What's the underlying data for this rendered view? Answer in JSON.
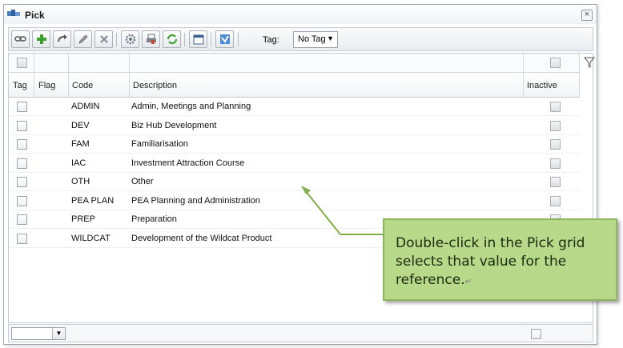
{
  "window": {
    "title": "Pick"
  },
  "toolbar": {
    "tag_label": "Tag:",
    "tag_value": "No Tag",
    "buttons": [
      "link-icon",
      "add-icon",
      "redo-icon",
      "edit-icon",
      "delete-icon",
      "settings-icon",
      "print-icon",
      "refresh-icon",
      "calendar-icon",
      "filter-pick-icon"
    ]
  },
  "grid": {
    "columns": {
      "tag": "Tag",
      "flag": "Flag",
      "code": "Code",
      "description": "Description",
      "inactive": "Inactive"
    },
    "rows": [
      {
        "code": "ADMIN",
        "description": "Admin, Meetings and Planning"
      },
      {
        "code": "DEV",
        "description": "Biz Hub Development"
      },
      {
        "code": "FAM",
        "description": "Familiarisation"
      },
      {
        "code": "IAC",
        "description": "Investment Attraction Course"
      },
      {
        "code": "OTH",
        "description": "Other"
      },
      {
        "code": "PEA PLAN",
        "description": "PEA Planning and Administration"
      },
      {
        "code": "PREP",
        "description": "Preparation"
      },
      {
        "code": "WILDCAT",
        "description": "Development of the Wildcat Product"
      }
    ]
  },
  "callout": {
    "text": "Double-click in the Pick grid selects that value for the reference."
  },
  "colors": {
    "callout_bg": "#b8d98a",
    "callout_border": "#8cb55e",
    "leader_line": "#7fae4a"
  }
}
